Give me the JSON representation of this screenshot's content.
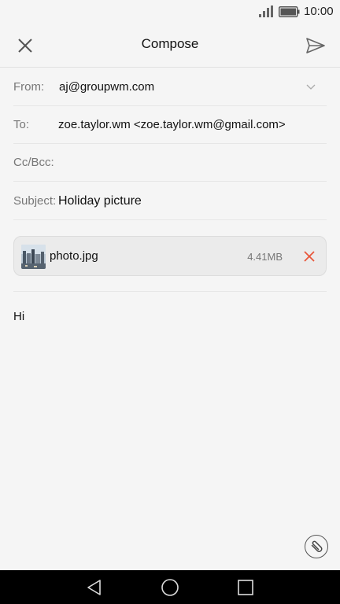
{
  "status_bar": {
    "time": "10:00",
    "icons": [
      "signal-icon",
      "battery-icon"
    ]
  },
  "header": {
    "title": "Compose",
    "close_icon": "close-icon",
    "send_icon": "send-icon"
  },
  "fields": {
    "from": {
      "label": "From:",
      "value": "aj@groupwm.com"
    },
    "to": {
      "label": "To:",
      "value": "zoe.taylor.wm <zoe.taylor.wm@gmail.com>"
    },
    "cc_bcc": {
      "label": "Cc/Bcc:",
      "value": ""
    },
    "subject": {
      "label": "Subject:",
      "value": "Holiday picture"
    }
  },
  "attachment": {
    "name": "photo.jpg",
    "size": "4.41MB",
    "remove_color": "#e8563a"
  },
  "body": {
    "text": "Hi"
  },
  "actions": {
    "attach_icon": "paperclip-icon"
  },
  "nav": {
    "items": [
      "back-icon",
      "home-icon",
      "recent-apps-icon"
    ]
  }
}
